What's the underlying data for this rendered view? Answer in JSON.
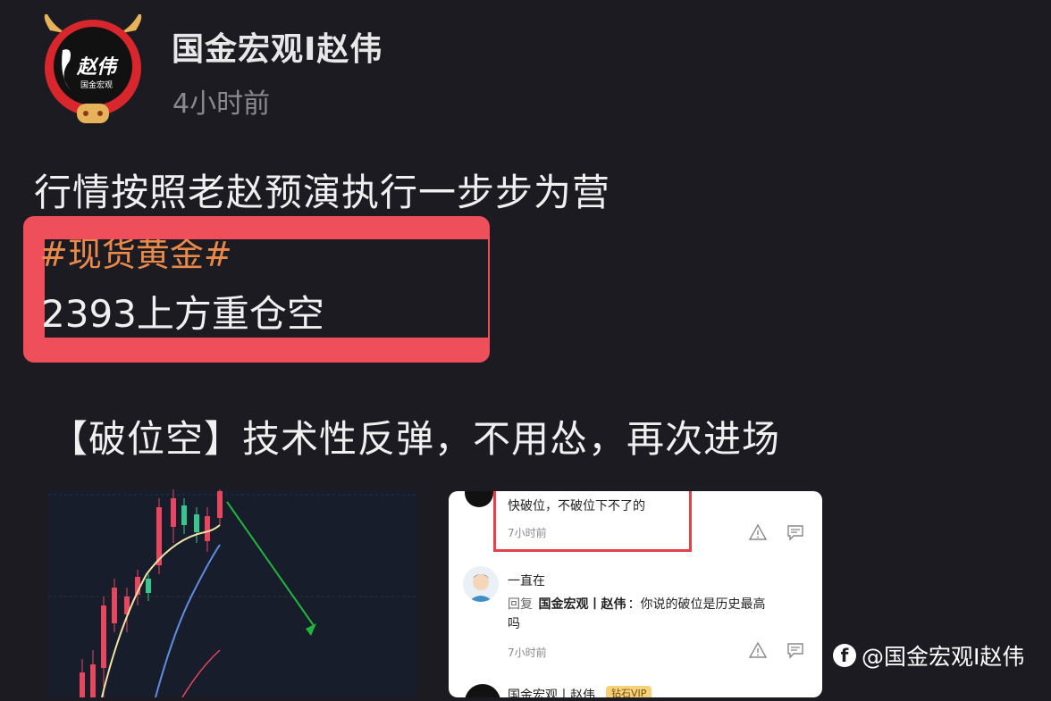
{
  "post": {
    "author": "国金宏观I赵伟",
    "time": "4小时前",
    "line1": "行情按照老赵预演执行一步步为营",
    "hashtag": "#现货黄金#",
    "price_line": "2393上方重仓空",
    "line2": "【破位空】技术性反弹，不用怂，再次进场"
  },
  "avatar": {
    "text_main": "赵伟",
    "text_sub": "国金宏观"
  },
  "comments": {
    "c1_text": "快破位，不破位下不了的",
    "c1_time": "7小时前",
    "c2_user": "一直在",
    "c2_reply_prefix": "回复",
    "c2_reply_to": "国金宏观丨赵伟",
    "c2_text_a": "：你说的破位是历史最高",
    "c2_text_b": "吗",
    "c2_time": "7小时前",
    "c3_user": "国金宏观丨赵伟",
    "c3_badge": "钻石VIP"
  },
  "watermark": {
    "text": "@国金宏观I赵伟",
    "icon": "facebook-icon"
  },
  "colors": {
    "background": "#1c1b22",
    "highlight_red": "#ee4f5a",
    "hashtag_orange": "#e98a4a",
    "candle_red": "#e8455f",
    "candle_green": "#37c68d",
    "arrow_green": "#22b53c"
  }
}
